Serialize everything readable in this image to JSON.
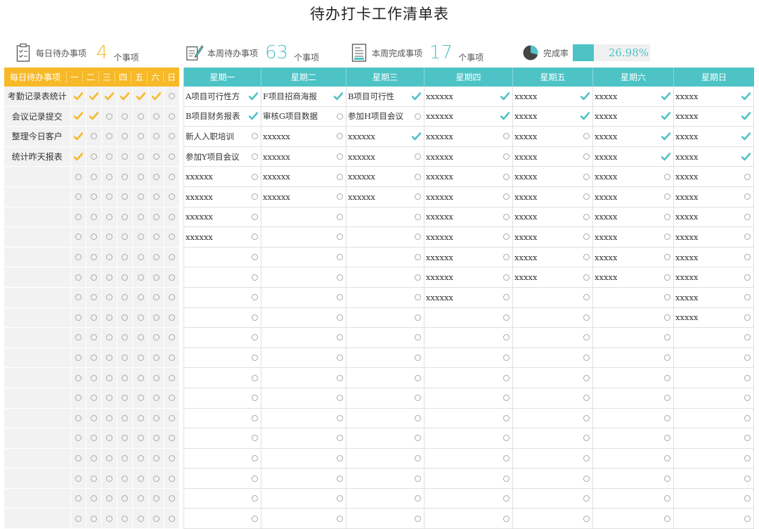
{
  "title": "待办打卡工作清单表",
  "summary": {
    "daily_label": "每日待办事项",
    "daily_count": "4",
    "daily_unit": "个事项",
    "week_label": "本周待办事项",
    "week_count": "63",
    "week_unit": "个事项",
    "done_label": "本周完成事项",
    "done_count": "17",
    "done_unit": "个事项",
    "rate_label": "完成率",
    "rate_value": "26.98%",
    "rate_fraction": 0.2698
  },
  "colors": {
    "yellow": "#f7b928",
    "teal": "#4ec3c6"
  },
  "daily": {
    "header": "每日待办事项",
    "days": [
      "一",
      "二",
      "三",
      "四",
      "五",
      "六",
      "日"
    ],
    "rows": [
      {
        "label": "考勤记录表统计",
        "checks": [
          1,
          1,
          1,
          1,
          1,
          1,
          0
        ]
      },
      {
        "label": "会议记录提交",
        "checks": [
          1,
          1,
          0,
          0,
          0,
          0,
          0
        ]
      },
      {
        "label": "整理今日客户",
        "checks": [
          1,
          0,
          0,
          0,
          0,
          0,
          0
        ]
      },
      {
        "label": "统计昨天报表",
        "checks": [
          1,
          0,
          0,
          0,
          0,
          0,
          0
        ]
      },
      {
        "label": "",
        "checks": [
          0,
          0,
          0,
          0,
          0,
          0,
          0
        ]
      },
      {
        "label": "",
        "checks": [
          0,
          0,
          0,
          0,
          0,
          0,
          0
        ]
      },
      {
        "label": "",
        "checks": [
          0,
          0,
          0,
          0,
          0,
          0,
          0
        ]
      },
      {
        "label": "",
        "checks": [
          0,
          0,
          0,
          0,
          0,
          0,
          0
        ]
      },
      {
        "label": "",
        "checks": [
          0,
          0,
          0,
          0,
          0,
          0,
          0
        ]
      },
      {
        "label": "",
        "checks": [
          0,
          0,
          0,
          0,
          0,
          0,
          0
        ]
      },
      {
        "label": "",
        "checks": [
          0,
          0,
          0,
          0,
          0,
          0,
          0
        ]
      },
      {
        "label": "",
        "checks": [
          0,
          0,
          0,
          0,
          0,
          0,
          0
        ]
      },
      {
        "label": "",
        "checks": [
          0,
          0,
          0,
          0,
          0,
          0,
          0
        ]
      },
      {
        "label": "",
        "checks": [
          0,
          0,
          0,
          0,
          0,
          0,
          0
        ]
      },
      {
        "label": "",
        "checks": [
          0,
          0,
          0,
          0,
          0,
          0,
          0
        ]
      },
      {
        "label": "",
        "checks": [
          0,
          0,
          0,
          0,
          0,
          0,
          0
        ]
      },
      {
        "label": "",
        "checks": [
          0,
          0,
          0,
          0,
          0,
          0,
          0
        ]
      },
      {
        "label": "",
        "checks": [
          0,
          0,
          0,
          0,
          0,
          0,
          0
        ]
      },
      {
        "label": "",
        "checks": [
          0,
          0,
          0,
          0,
          0,
          0,
          0
        ]
      },
      {
        "label": "",
        "checks": [
          0,
          0,
          0,
          0,
          0,
          0,
          0
        ]
      },
      {
        "label": "",
        "checks": [
          0,
          0,
          0,
          0,
          0,
          0,
          0
        ]
      },
      {
        "label": "",
        "checks": [
          0,
          0,
          0,
          0,
          0,
          0,
          0
        ]
      }
    ]
  },
  "weekly": {
    "days": [
      "星期一",
      "星期二",
      "星期三",
      "星期四",
      "星期五",
      "星期六",
      "星期日"
    ],
    "columns": [
      [
        [
          "A项目可行性方",
          1
        ],
        [
          "B项目财务报表",
          1
        ],
        [
          "新人入职培训",
          0
        ],
        [
          "参加Y项目会议",
          0
        ],
        [
          "xxxxxx",
          0
        ],
        [
          "xxxxxx",
          0
        ],
        [
          "xxxxxx",
          0
        ],
        [
          "xxxxxx",
          0
        ]
      ],
      [
        [
          "F项目招商海报",
          1
        ],
        [
          "审核G项目数据",
          0
        ],
        [
          "xxxxxx",
          0
        ],
        [
          "xxxxxx",
          0
        ],
        [
          "xxxxxx",
          0
        ],
        [
          "xxxxxx",
          0
        ]
      ],
      [
        [
          "B项目可行性",
          1
        ],
        [
          "参加H项目会议",
          0
        ],
        [
          "xxxxxx",
          1
        ],
        [
          "xxxxxx",
          0
        ],
        [
          "xxxxxx",
          0
        ],
        [
          "xxxxxx",
          0
        ]
      ],
      [
        [
          "xxxxxx",
          1
        ],
        [
          "xxxxxx",
          1
        ],
        [
          "xxxxxx",
          0
        ],
        [
          "xxxxxx",
          0
        ],
        [
          "xxxxxx",
          0
        ],
        [
          "xxxxxx",
          0
        ],
        [
          "xxxxxx",
          0
        ],
        [
          "xxxxxx",
          0
        ],
        [
          "xxxxxx",
          0
        ],
        [
          "xxxxxx",
          0
        ],
        [
          "xxxxxx",
          0
        ]
      ],
      [
        [
          "xxxxx",
          1
        ],
        [
          "xxxxx",
          1
        ],
        [
          "xxxxx",
          0
        ],
        [
          "xxxxx",
          0
        ],
        [
          "xxxxx",
          0
        ],
        [
          "xxxxx",
          0
        ],
        [
          "xxxxx",
          0
        ],
        [
          "xxxxx",
          0
        ],
        [
          "xxxxx",
          0
        ],
        [
          "xxxxx",
          0
        ]
      ],
      [
        [
          "xxxxx",
          1
        ],
        [
          "xxxxx",
          1
        ],
        [
          "xxxxx",
          1
        ],
        [
          "xxxxx",
          1
        ],
        [
          "xxxxx",
          0
        ],
        [
          "xxxxx",
          0
        ],
        [
          "xxxxx",
          0
        ],
        [
          "xxxxx",
          0
        ],
        [
          "xxxxx",
          0
        ],
        [
          "xxxxx",
          0
        ]
      ],
      [
        [
          "xxxxx",
          1
        ],
        [
          "xxxxx",
          1
        ],
        [
          "xxxxx",
          1
        ],
        [
          "xxxxx",
          1
        ],
        [
          "xxxxx",
          0
        ],
        [
          "xxxxx",
          0
        ],
        [
          "xxxxx",
          0
        ],
        [
          "xxxxx",
          0
        ],
        [
          "xxxxx",
          0
        ],
        [
          "xxxxx",
          0
        ],
        [
          "xxxxx",
          0
        ],
        [
          "xxxxx",
          0
        ]
      ]
    ]
  }
}
